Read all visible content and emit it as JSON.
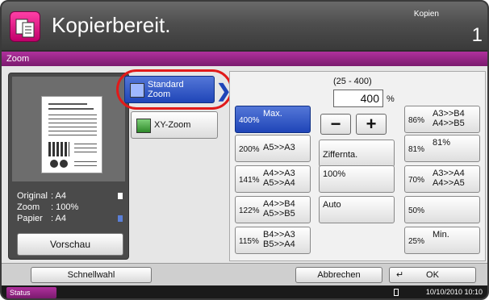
{
  "header": {
    "title": "Kopierbereit.",
    "copies_label": "Kopien",
    "copies_count": "1"
  },
  "zoom_bar": {
    "title": "Zoom"
  },
  "left_panel": {
    "info": [
      {
        "key": "Original",
        "value": ": A4"
      },
      {
        "key": "Zoom",
        "value": ": 100%"
      },
      {
        "key": "Papier",
        "value": ": A4"
      }
    ],
    "preview_button": "Vorschau"
  },
  "modes": {
    "standard": {
      "line1": "Standard",
      "line2": "Zoom"
    },
    "xy": {
      "label": "XY-Zoom"
    }
  },
  "zoom": {
    "range": "(25 - 400)",
    "value": "400",
    "unit": "%",
    "minus": "−",
    "plus": "+",
    "left_column": [
      {
        "pct": "400%",
        "line1": "Max.",
        "line2": "",
        "active": true
      },
      {
        "pct": "200%",
        "line1": "A5>>A3",
        "line2": ""
      },
      {
        "pct": "141%",
        "line1": "A4>>A3",
        "line2": "A5>>A4"
      },
      {
        "pct": "122%",
        "line1": "A4>>B4",
        "line2": "A5>>B5"
      },
      {
        "pct": "115%",
        "line1": "B4>>A3",
        "line2": "B5>>A4"
      }
    ],
    "middle_column": [
      {
        "label": "Ziffernta."
      },
      {
        "label": "100%"
      },
      {
        "label": "Auto"
      }
    ],
    "right_column": [
      {
        "pct": "86%",
        "line1": "A3>>B4",
        "line2": "A4>>B5"
      },
      {
        "pct": "81%",
        "line1": "81%",
        "line2": ""
      },
      {
        "pct": "70%",
        "line1": "A3>>A4",
        "line2": "A4>>A5"
      },
      {
        "pct": "50%",
        "line1": "",
        "line2": ""
      },
      {
        "pct": "25%",
        "line1": "Min.",
        "line2": ""
      }
    ]
  },
  "bottom_bar": {
    "quick": "Schnellwahl",
    "cancel": "Abbrechen",
    "ok": "OK"
  },
  "status_bar": {
    "status": "Status",
    "datetime": "10/10/2010  10:10"
  }
}
